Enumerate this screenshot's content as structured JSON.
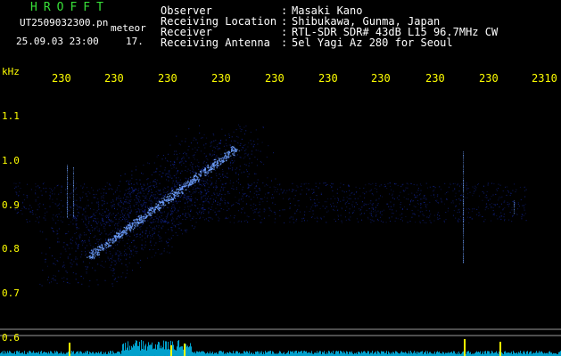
{
  "app": {
    "logo_text": "HROFFT",
    "file_name": "UT2509032300.pn",
    "file_name_suffix": "meteor",
    "date_time": "25.09.03 23:00",
    "frame_number": "17."
  },
  "header": {
    "fields": [
      {
        "label": "Observer",
        "value": "Masaki Kano"
      },
      {
        "label": "Receiving Location",
        "value": "Shibukawa, Gunma, Japan"
      },
      {
        "label": "Receiver",
        "value": "RTL-SDR SDR# 43dB L15 96.7MHz CW"
      },
      {
        "label": "Receiving Antenna",
        "value": "5el Yagi Az 280 for Seoul"
      }
    ]
  },
  "axes": {
    "y_unit": "kHz",
    "y_ticks": [
      "1.1",
      "1.0",
      "0.9",
      "0.8",
      "0.7",
      "0.6"
    ],
    "x_ticks": [
      "230",
      "230",
      "230",
      "230",
      "230",
      "230",
      "230",
      "230",
      "230",
      "2310"
    ]
  },
  "colors": {
    "background": "#000000",
    "axis_text": "#ffff00",
    "logo": "#38e038",
    "signal_weak": "#1428a0",
    "signal_strong": "#6ea0ff",
    "level_bar": "#00c8ff"
  }
}
